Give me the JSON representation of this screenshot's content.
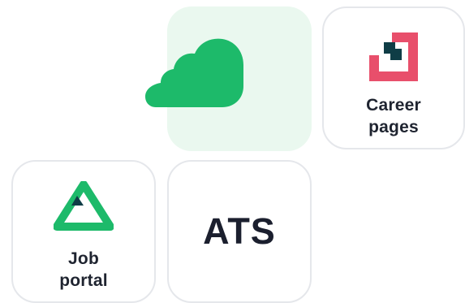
{
  "tiles": {
    "cloud": {
      "icon": "cloud-icon",
      "bg_color": "#eaf8ef",
      "icon_color": "#1dba6a"
    },
    "career_pages": {
      "label": "Career\npages",
      "icon": "career-pages-logo-icon",
      "icon_colors": [
        "#e84f6b",
        "#0f3d46"
      ]
    },
    "job_portal": {
      "label": "Job\nportal",
      "icon": "job-portal-triangle-icon",
      "icon_colors": [
        "#1dba6a",
        "#0f3d46"
      ]
    },
    "ats": {
      "label": "ATS"
    }
  },
  "colors": {
    "card_border": "#e5e7eb",
    "text": "#1f2430"
  }
}
